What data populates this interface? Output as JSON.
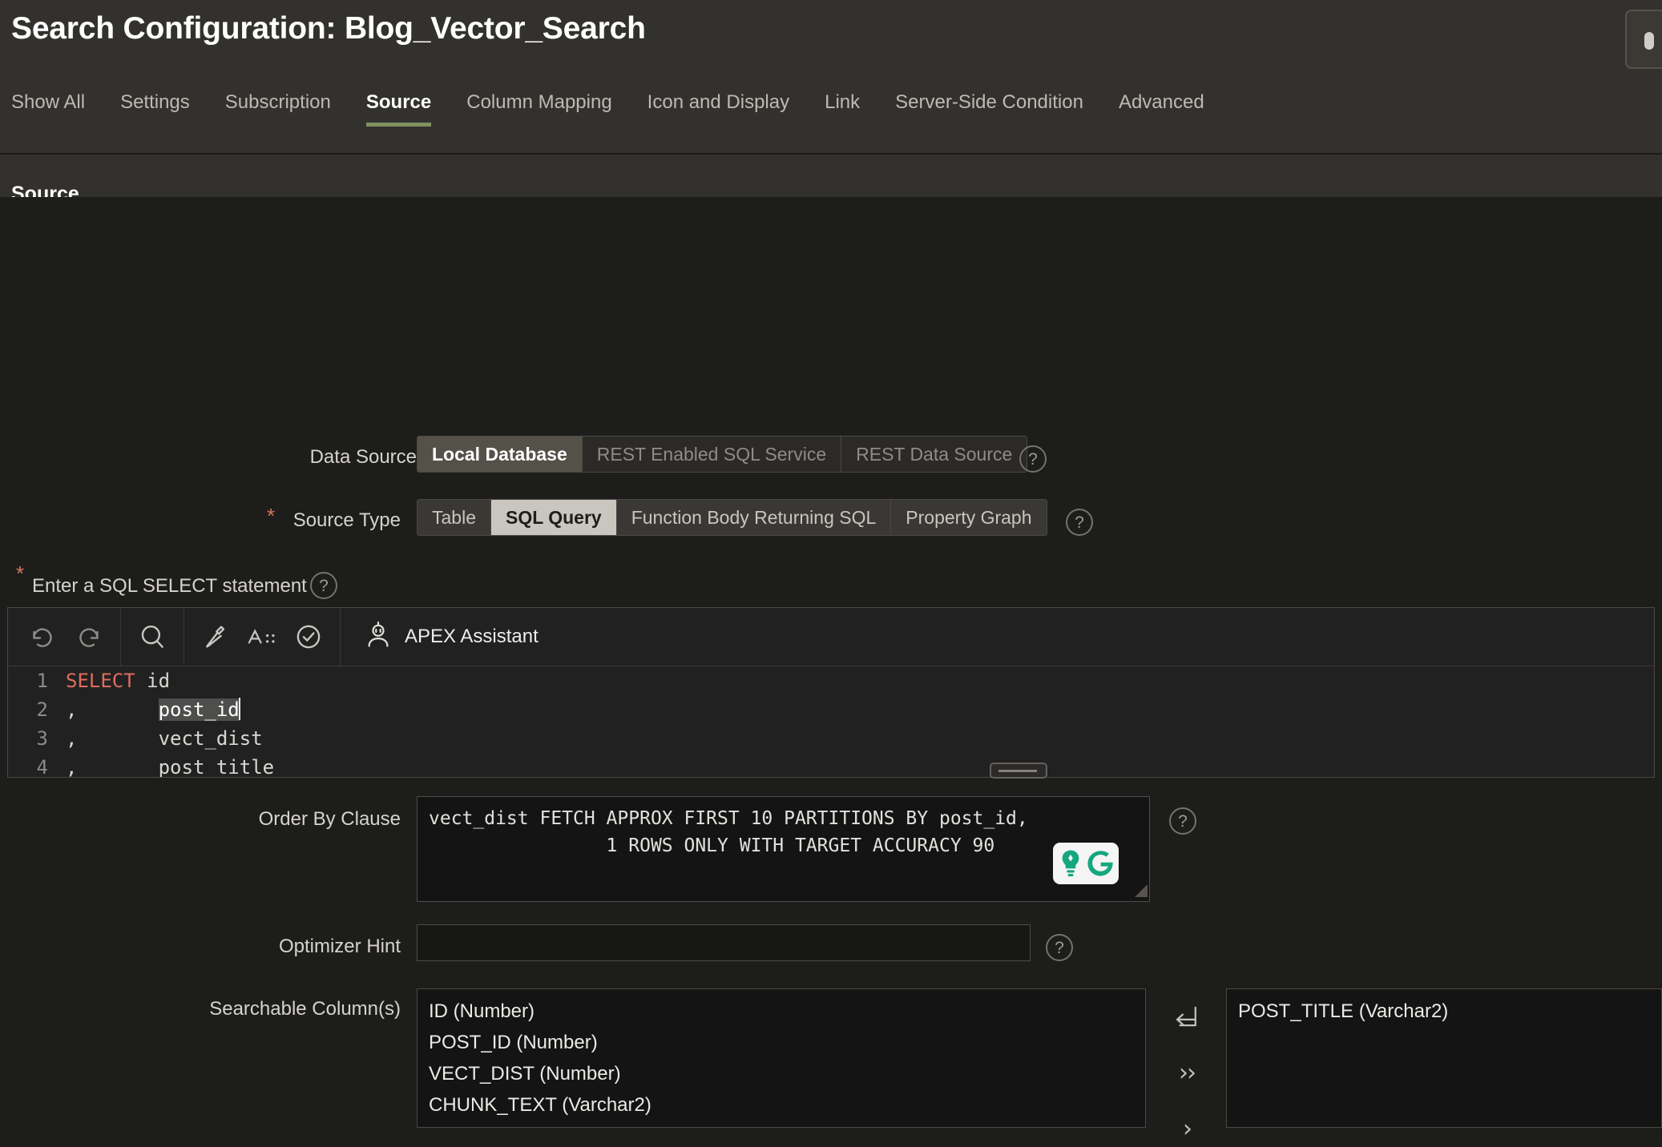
{
  "header": {
    "title": "Search Configuration: Blog_Vector_Search",
    "tabs": [
      {
        "label": "Show All",
        "active": false
      },
      {
        "label": "Settings",
        "active": false
      },
      {
        "label": "Subscription",
        "active": false
      },
      {
        "label": "Source",
        "active": true
      },
      {
        "label": "Column Mapping",
        "active": false
      },
      {
        "label": "Icon and Display",
        "active": false
      },
      {
        "label": "Link",
        "active": false
      },
      {
        "label": "Server-Side Condition",
        "active": false
      },
      {
        "label": "Advanced",
        "active": false
      }
    ],
    "active_tab_underline_color": "#7f9160"
  },
  "section": {
    "title": "Source"
  },
  "data_source": {
    "label": "Data Source",
    "options": [
      "Local Database",
      "REST Enabled SQL Service",
      "REST Data Source"
    ],
    "selected": "Local Database",
    "help": "?"
  },
  "source_type": {
    "label": "Source Type",
    "required_marker": "*",
    "options": [
      "Table",
      "SQL Query",
      "Function Body Returning SQL",
      "Property Graph"
    ],
    "selected": "SQL Query",
    "help": "?"
  },
  "sql_editor": {
    "label": "Enter a SQL SELECT statement",
    "required_marker": "*",
    "help": "?",
    "toolbar": {
      "undo": "undo-icon",
      "redo": "redo-icon",
      "find": "search-icon",
      "format": "hammer-icon",
      "font_size": "A",
      "validate": "check-circle-icon",
      "assistant_label": "APEX Assistant",
      "assistant_icon": "assistant-avatar-icon"
    },
    "lines": [
      {
        "num": "1",
        "keyword": "SELECT",
        "text": " id",
        "selected": ""
      },
      {
        "num": "2",
        "keyword": "",
        "text": ",       ",
        "selected": "post_id",
        "caret": true
      },
      {
        "num": "3",
        "keyword": "",
        "text": ",       vect_dist",
        "selected": ""
      },
      {
        "num": "4",
        "keyword": "",
        "text": ",       post_title",
        "selected": ""
      }
    ]
  },
  "order_by": {
    "label": "Order By Clause",
    "value": "vect_dist FETCH APPROX FIRST 10 PARTITIONS BY post_id,\n                1 ROWS ONLY WITH TARGET ACCURACY 90",
    "help": "?",
    "grammarly_badge": "grammarly-icon"
  },
  "optimizer_hint": {
    "label": "Optimizer Hint",
    "value": "",
    "placeholder": "",
    "help": "?"
  },
  "searchable_columns": {
    "label": "Searchable Column(s)",
    "available": [
      "ID (Number)",
      "POST_ID (Number)",
      "VECT_DIST (Number)",
      "CHUNK_TEXT (Varchar2)"
    ],
    "selected": [
      "POST_TITLE (Varchar2)"
    ],
    "buttons": [
      {
        "name": "reset",
        "glyph": "reset-arrow-icon"
      },
      {
        "name": "move-all-right",
        "glyph": "››"
      },
      {
        "name": "move-right",
        "glyph": "›"
      }
    ]
  },
  "colors": {
    "page_bg": "#1d1d1b",
    "header_bg": "#33312e",
    "field_bg": "#141414",
    "border": "#4a4844",
    "accent_green": "#7f9160",
    "required_red": "#d4785c",
    "sql_keyword": "#e06c5e",
    "grammarly_green": "#15a77f"
  }
}
